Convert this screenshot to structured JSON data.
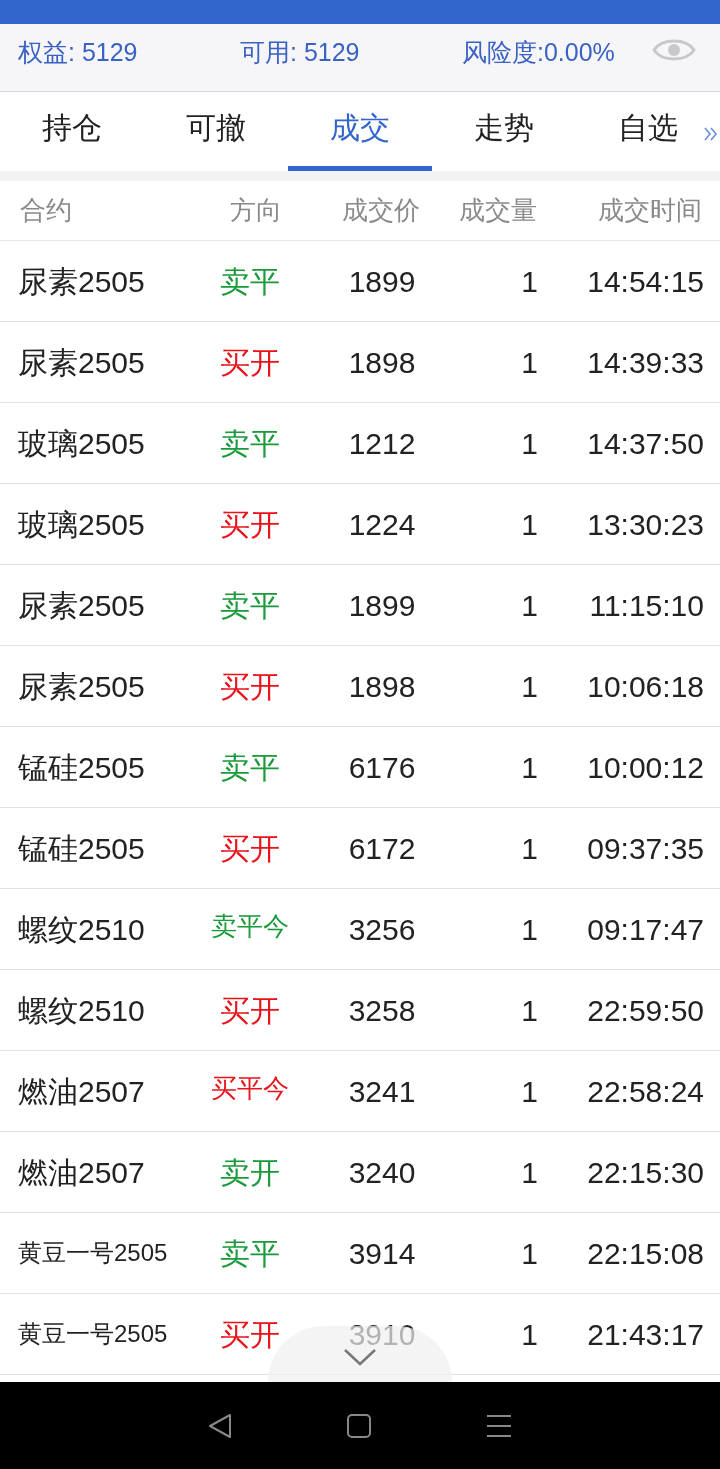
{
  "summary": [
    {
      "label": "权益: 5129"
    },
    {
      "label": "可用: 5129"
    },
    {
      "label": "风险度:0.00%"
    }
  ],
  "tabs": [
    {
      "label": "持仓",
      "selected": false
    },
    {
      "label": "可撤",
      "selected": false
    },
    {
      "label": "成交",
      "selected": true
    },
    {
      "label": "走势",
      "selected": false
    },
    {
      "label": "自选",
      "selected": false
    }
  ],
  "table": {
    "columns": [
      "合约",
      "方向",
      "成交价",
      "成交量",
      "成交时间"
    ],
    "rows": [
      {
        "contract": "尿素2505",
        "direction": "卖平",
        "color": "#1a9a3a",
        "price": "1899",
        "volume": "1",
        "time": "14:54:15"
      },
      {
        "contract": "尿素2505",
        "direction": "买开",
        "color": "#e8131b",
        "price": "1898",
        "volume": "1",
        "time": "14:39:33"
      },
      {
        "contract": "玻璃2505",
        "direction": "卖平",
        "color": "#1a9a3a",
        "price": "1212",
        "volume": "1",
        "time": "14:37:50"
      },
      {
        "contract": "玻璃2505",
        "direction": "买开",
        "color": "#e8131b",
        "price": "1224",
        "volume": "1",
        "time": "13:30:23"
      },
      {
        "contract": "尿素2505",
        "direction": "卖平",
        "color": "#1a9a3a",
        "price": "1899",
        "volume": "1",
        "time": "11:15:10"
      },
      {
        "contract": "尿素2505",
        "direction": "买开",
        "color": "#e8131b",
        "price": "1898",
        "volume": "1",
        "time": "10:06:18"
      },
      {
        "contract": "锰硅2505",
        "direction": "卖平",
        "color": "#1a9a3a",
        "price": "6176",
        "volume": "1",
        "time": "10:00:12"
      },
      {
        "contract": "锰硅2505",
        "direction": "买开",
        "color": "#e8131b",
        "price": "6172",
        "volume": "1",
        "time": "09:37:35"
      },
      {
        "contract": "螺纹2510",
        "direction": "卖平今",
        "color": "#1a9a3a",
        "price": "3256",
        "volume": "1",
        "time": "09:17:47"
      },
      {
        "contract": "螺纹2510",
        "direction": "买开",
        "color": "#e8131b",
        "price": "3258",
        "volume": "1",
        "time": "22:59:50"
      },
      {
        "contract": "燃油2507",
        "direction": "买平今",
        "color": "#e8131b",
        "price": "3241",
        "volume": "1",
        "time": "22:58:24"
      },
      {
        "contract": "燃油2507",
        "direction": "卖开",
        "color": "#1a9a3a",
        "price": "3240",
        "volume": "1",
        "time": "22:15:30"
      },
      {
        "contract": "黄豆一号2505",
        "direction": "卖平",
        "color": "#1a9a3a",
        "price": "3914",
        "volume": "1",
        "time": "22:15:08"
      },
      {
        "contract": "黄豆一号2505",
        "direction": "买开",
        "color": "#e8131b",
        "price": "3910",
        "volume": "1",
        "time": "21:43:17"
      }
    ]
  }
}
